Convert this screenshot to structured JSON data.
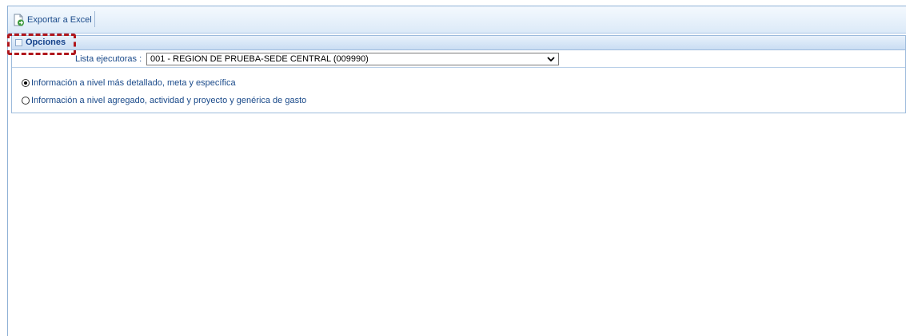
{
  "toolbar": {
    "export_label": "Exportar a Excel"
  },
  "panel": {
    "title": "Opciones",
    "executor_label": "Lista ejecutoras :",
    "executor_selected": "001 - REGION DE PRUEBA-SEDE CENTRAL (009990)",
    "options": [
      {
        "label": "Información a nivel más detallado, meta y específica",
        "checked": true
      },
      {
        "label": "Información a nivel agregado, actividad y proyecto y genérica de gasto",
        "checked": false
      }
    ]
  },
  "colors": {
    "text": "#1a4a8a",
    "header_gradient_start": "#e8f1fb",
    "header_gradient_end": "#c9ddf3",
    "highlight": "#b0161c"
  },
  "icons": [
    "excel-export-icon",
    "collapse-icon",
    "chevron-down-icon"
  ]
}
